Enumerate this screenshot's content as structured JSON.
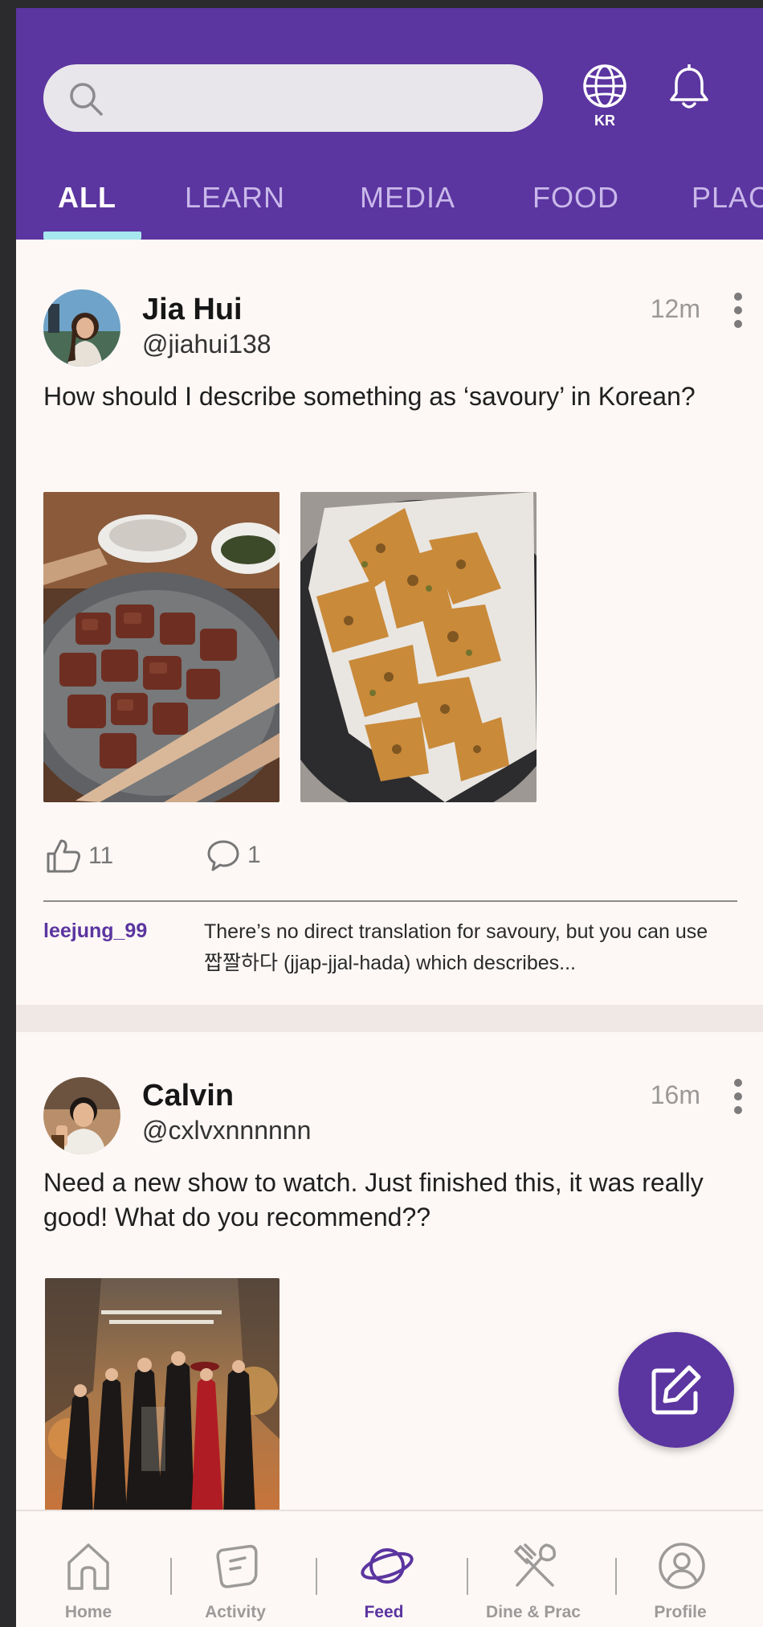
{
  "header": {
    "search_placeholder": "",
    "language_code": "KR",
    "tabs": [
      "ALL",
      "LEARN",
      "MEDIA",
      "FOOD",
      "PLAC"
    ],
    "active_tab": "ALL"
  },
  "posts": [
    {
      "name": "Jia Hui",
      "handle": "@jiahui138",
      "time": "12m",
      "text": "How should I describe something as ‘savoury’ in Korean?",
      "likes": "11",
      "comments": "1",
      "top_comment": {
        "user": "leejung_99",
        "text": "There’s no direct translation for savoury, but you can use 짭짤하다 (jjap-jjal-hada) which describes..."
      }
    },
    {
      "name": "Calvin",
      "handle": "@cxlvxnnnnnn",
      "time": "16m",
      "text": "Need a new show to watch. Just finished this, it was really good! What do you recommend??"
    }
  ],
  "nav": {
    "items": [
      "Home",
      "Activity",
      "Feed",
      "Dine & Prac",
      "Profile"
    ],
    "active": "Feed"
  },
  "colors": {
    "brand_purple": "#5b35a0",
    "tab_indicator": "#a7e8ee",
    "background": "#fdf8f6"
  }
}
